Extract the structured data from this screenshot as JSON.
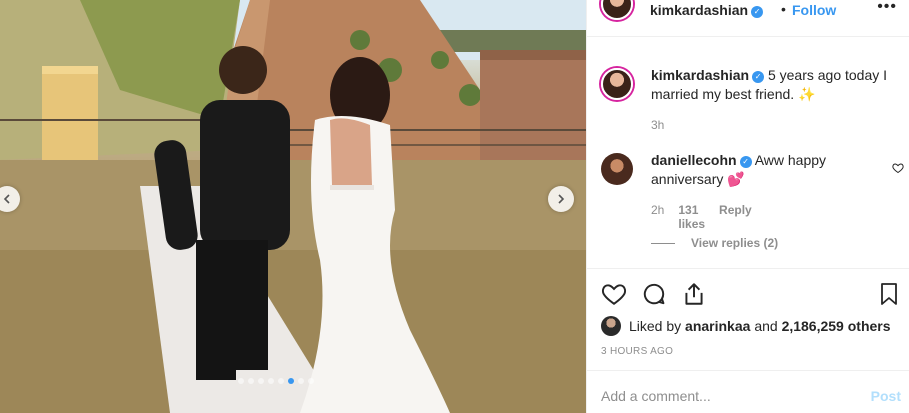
{
  "post": {
    "username": "kimkardashian",
    "verified_glyph": "✓",
    "separator": "•",
    "follow_label": "Follow",
    "more_label": "•••"
  },
  "caption": {
    "username": "kimkardashian",
    "text": "5 years ago today I married my best friend. ✨",
    "time": "3h"
  },
  "comments": [
    {
      "username": "daniellecohn",
      "text": "Aww happy anniversary 💕",
      "time": "2h",
      "likes": "131 likes",
      "reply_label": "Reply",
      "view_replies": "View replies (2)"
    }
  ],
  "likes": {
    "prefix": "Liked by",
    "liker": "anarinkaa",
    "joiner": "and",
    "others": "2,186,259 others"
  },
  "timestamp": "3 HOURS AGO",
  "comment_box": {
    "placeholder": "Add a comment...",
    "post_label": "Post"
  },
  "carousel": {
    "total_slides": 8,
    "active_slide": 6
  },
  "colors": {
    "accent": "#3897f0",
    "muted": "#8e8e8e",
    "post_disabled": "#b2dffc"
  },
  "icons": [
    "chevron-left-icon",
    "chevron-right-icon",
    "heart-icon",
    "comment-icon",
    "share-icon",
    "bookmark-icon",
    "verified-icon"
  ]
}
